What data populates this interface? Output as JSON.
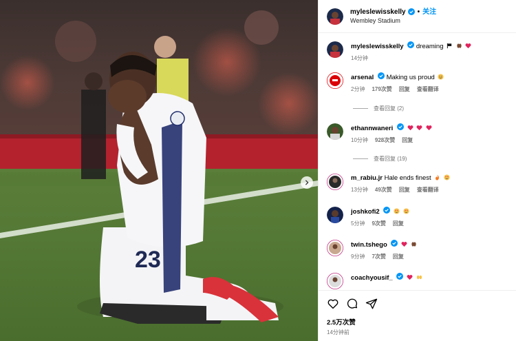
{
  "header": {
    "username": "myleslewisskelly",
    "separator": "•",
    "follow_label": "关注",
    "location": "Wembley Stadium"
  },
  "caption": {
    "username": "myleslewisskelly",
    "text": "dreaming",
    "time": "14分钟"
  },
  "comments": [
    {
      "username": "arsenal",
      "verified": true,
      "text": "Making us proud",
      "time": "2分钟",
      "likes": "179次赞",
      "reply": "回复",
      "translate": "查看翻译",
      "replies": "查看回复 (2)"
    },
    {
      "username": "ethannwaneri",
      "verified": true,
      "text": "",
      "time": "10分钟",
      "likes": "928次赞",
      "reply": "回复",
      "replies": "查看回复 (19)"
    },
    {
      "username": "m_rabiu.jr",
      "verified": false,
      "text": "Hale ends finest",
      "time": "13分钟",
      "likes": "49次赞",
      "reply": "回复",
      "translate": "查看翻译"
    },
    {
      "username": "joshkofi2",
      "verified": true,
      "text": "",
      "time": "5分钟",
      "likes": "9次赞",
      "reply": "回复"
    },
    {
      "username": "twin.tshego",
      "verified": true,
      "text": "",
      "time": "9分钟",
      "likes": "7次赞",
      "reply": "回复"
    },
    {
      "username": "coachyousif_",
      "verified": true,
      "text": "",
      "time": "",
      "likes": "",
      "reply": ""
    }
  ],
  "footer": {
    "likes": "2.5万次赞",
    "time": "14分钟前"
  },
  "photo": {
    "jersey_number": "23"
  },
  "icons": {
    "like": "heart-icon",
    "comment": "comment-icon",
    "share": "share-icon",
    "next": "chevron-right-icon"
  },
  "colors": {
    "accent": "#0095f6",
    "verified": "#0095f6",
    "meta": "#737373"
  }
}
